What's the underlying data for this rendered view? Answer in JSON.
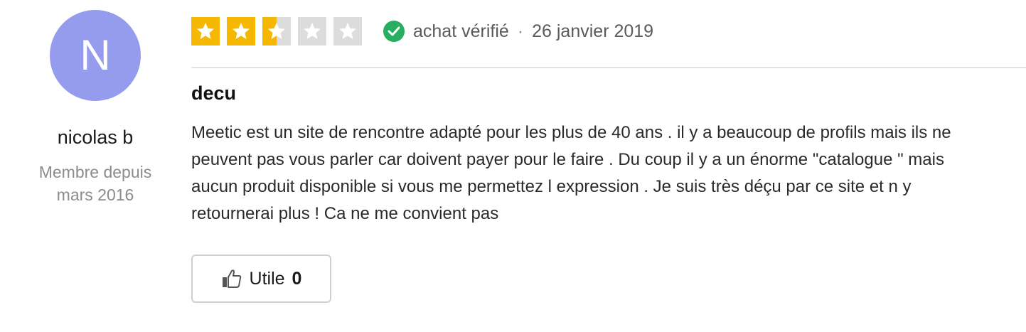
{
  "reviewer": {
    "initial": "N",
    "name": "nicolas b",
    "member_since": "Membre depuis mars 2016",
    "avatar_color": "#959cee"
  },
  "rating": {
    "value": 2.5,
    "max": 5,
    "star_color": "#f5b700",
    "empty_color": "#dcdcdc"
  },
  "verified": {
    "icon": "check-circle-icon",
    "label": "achat vérifié",
    "color": "#27ae60"
  },
  "separator": "·",
  "date": "26 janvier 2019",
  "review": {
    "title": "decu",
    "body": "Meetic est un site de rencontre adapté pour les plus de 40 ans . il y a beaucoup de profils mais ils ne peuvent pas vous parler car doivent payer pour le faire . Du coup il y a un énorme \"catalogue \" mais aucun produit disponible si vous me permettez l expression . Je suis très déçu par ce site et n y retournerai plus ! Ca ne me convient pas"
  },
  "useful_button": {
    "icon": "thumbs-up-icon",
    "label": "Utile",
    "count": "0"
  }
}
